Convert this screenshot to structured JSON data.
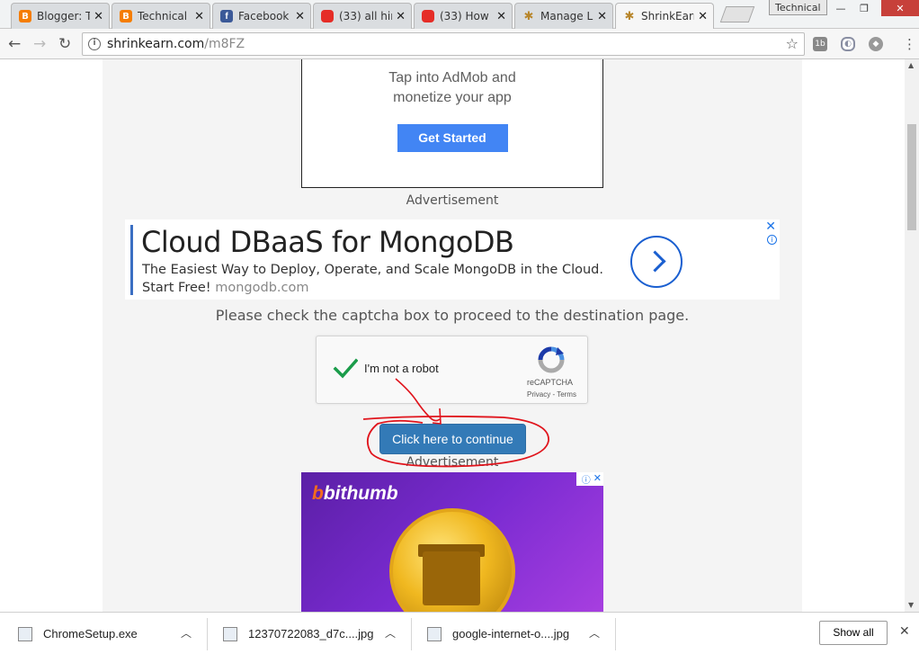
{
  "tabs": [
    {
      "title": "Blogger: T",
      "favicon": "blogger-icon"
    },
    {
      "title": "Technical",
      "favicon": "blogger-icon"
    },
    {
      "title": "Facebook",
      "favicon": "facebook-icon"
    },
    {
      "title": "(33) all hir",
      "favicon": "youtube-icon"
    },
    {
      "title": "(33) How",
      "favicon": "youtube-icon"
    },
    {
      "title": "Manage L",
      "favicon": "manage-icon"
    },
    {
      "title": "ShrinkEarn",
      "favicon": "shrinkearn-icon",
      "active": true
    }
  ],
  "tab_close_glyph": "✕",
  "profile_name": "Technical",
  "address": {
    "host": "shrinkearn.com",
    "path": "/m8FZ"
  },
  "admob_ad": {
    "line1": "Tap into AdMob and",
    "line2": "monetize your app",
    "button": "Get Started"
  },
  "advertisement_label": "Advertisement",
  "mongo_ad": {
    "title": "Cloud DBaaS for MongoDB",
    "line1": "The Easiest Way to Deploy, Operate, and Scale MongoDB in the Cloud.",
    "line2_cta": "Start Free!",
    "domain": "mongodb.com"
  },
  "captcha_prompt": "Please check the captcha box to proceed to the destination page.",
  "recaptcha": {
    "label": "I'm not a robot",
    "brand": "reCAPTCHA",
    "terms": "Privacy - Terms",
    "checked": true
  },
  "continue_button": "Click here to continue",
  "bithumb_ad": {
    "logo": "bithumb"
  },
  "downloads": [
    {
      "name": "ChromeSetup.exe"
    },
    {
      "name": "12370722083_d7c....jpg"
    },
    {
      "name": "google-internet-o....jpg"
    }
  ],
  "show_all": "Show all",
  "colors": {
    "accent_blue": "#337ab7",
    "admob_blue": "#4285f4",
    "annotation_red": "#e0141c",
    "check_green": "#1a9c4a"
  }
}
